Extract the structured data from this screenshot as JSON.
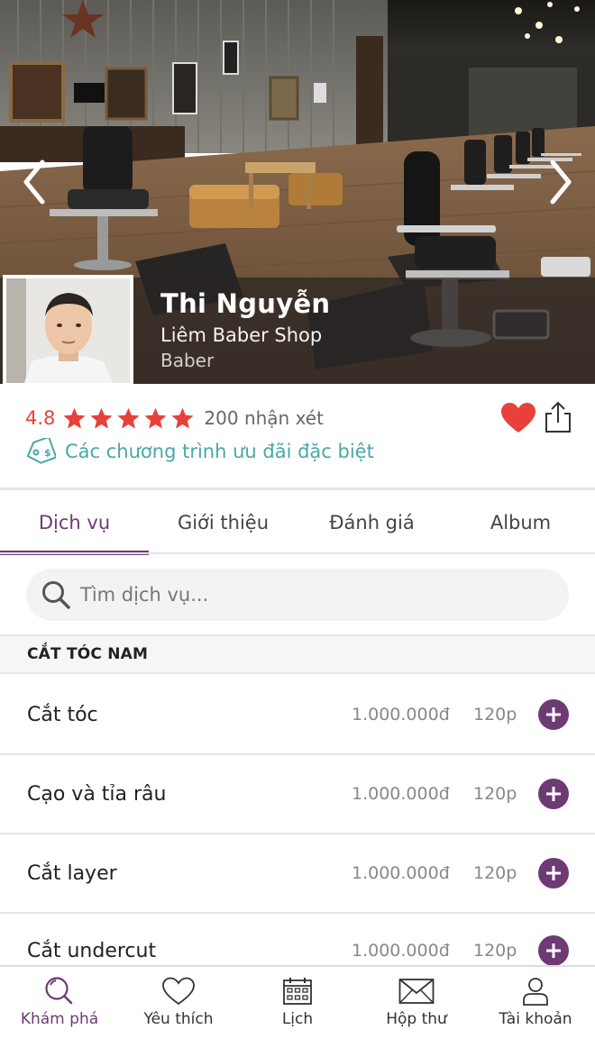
{
  "profile": {
    "name": "Thi Nguyễn",
    "shop": "Liêm Baber Shop",
    "role": "Baber"
  },
  "rating": {
    "value": "4.8",
    "stars": 5,
    "review_count": "200 nhận xét",
    "star_color": "#e8413a"
  },
  "promo": {
    "label": "Các chương trình ưu đãi đặc biệt",
    "color": "#4aa7a6"
  },
  "tabs": [
    {
      "label": "Dịch vụ",
      "active": true
    },
    {
      "label": "Giới thiệu",
      "active": false
    },
    {
      "label": "Đánh giá",
      "active": false
    },
    {
      "label": "Album",
      "active": false
    }
  ],
  "search": {
    "placeholder": "Tìm dịch vụ..."
  },
  "category": {
    "title": "CẮT TÓC NAM"
  },
  "services": [
    {
      "name": "Cắt tóc",
      "price": "1.000.000đ",
      "duration": "120p"
    },
    {
      "name": "Cạo và tỉa râu",
      "price": "1.000.000đ",
      "duration": "120p"
    },
    {
      "name": "Cắt layer",
      "price": "1.000.000đ",
      "duration": "120p"
    },
    {
      "name": "Cắt undercut",
      "price": "1.000.000đ",
      "duration": "120p"
    }
  ],
  "bottom_nav": [
    {
      "label": "Khám phá",
      "icon": "search-icon",
      "active": true
    },
    {
      "label": "Yêu thích",
      "icon": "heart-outline-icon",
      "active": false
    },
    {
      "label": "Lịch",
      "icon": "calendar-icon",
      "active": false
    },
    {
      "label": "Hộp thư",
      "icon": "mail-icon",
      "active": false
    },
    {
      "label": "Tài khoản",
      "icon": "user-icon",
      "active": false
    }
  ],
  "colors": {
    "accent": "#6e3a74",
    "favorite": "#e8413a",
    "promo": "#4aa7a6"
  }
}
